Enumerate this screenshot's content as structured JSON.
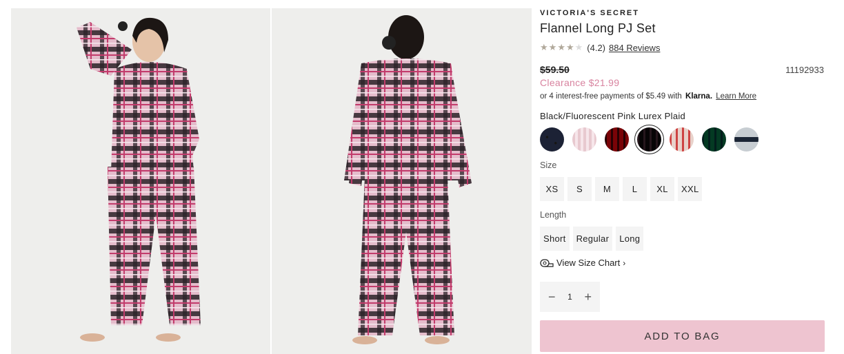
{
  "product": {
    "brand": "VICTORIA'S SECRET",
    "title": "Flannel Long PJ Set",
    "rating_text": "(4.2)",
    "rating_value": 4.2,
    "reviews_link": "884 Reviews",
    "original_price": "$59.50",
    "sku": "11192933",
    "sale_price": "Clearance $21.99",
    "klarna": {
      "text": "or 4 interest-free payments of $5.49 with",
      "brand": "Klarna.",
      "learn_more": "Learn More"
    }
  },
  "color": {
    "selected_name": "Black/Fluorescent Pink Lurex Plaid",
    "swatches": [
      {
        "name": "navy-star-print",
        "colors": [
          "#1c2235",
          "#c9a85a"
        ]
      },
      {
        "name": "pink-stripe",
        "colors": [
          "#e8c9cf",
          "#f6e6ea"
        ]
      },
      {
        "name": "red-plaid",
        "colors": [
          "#b01a2b",
          "#3a0d14"
        ]
      },
      {
        "name": "black-pink-plaid",
        "colors": [
          "#2b2228",
          "#d9a3b5"
        ],
        "selected": true
      },
      {
        "name": "white-red-plaid",
        "colors": [
          "#f3e7e3",
          "#d84a4a"
        ]
      },
      {
        "name": "green-plaid",
        "colors": [
          "#1f7a5e",
          "#0f3c4c"
        ]
      },
      {
        "name": "grey-navy-plaid",
        "colors": [
          "#c7cdd2",
          "#1b2535"
        ]
      }
    ]
  },
  "size": {
    "label": "Size",
    "options": [
      "XS",
      "S",
      "M",
      "L",
      "XL",
      "XXL"
    ]
  },
  "length": {
    "label": "Length",
    "options": [
      "Short",
      "Regular",
      "Long"
    ]
  },
  "size_chart": {
    "label": "View Size Chart",
    "chevron": "›"
  },
  "quantity": {
    "minus": "−",
    "value": "1",
    "plus": "+"
  },
  "add_to_bag": "ADD TO BAG",
  "gallery": {
    "background": "#eeeeec",
    "plaid_colors": [
      "#2b2228",
      "#d9a3b5",
      "#f2dfe6",
      "#c23b6b"
    ]
  }
}
